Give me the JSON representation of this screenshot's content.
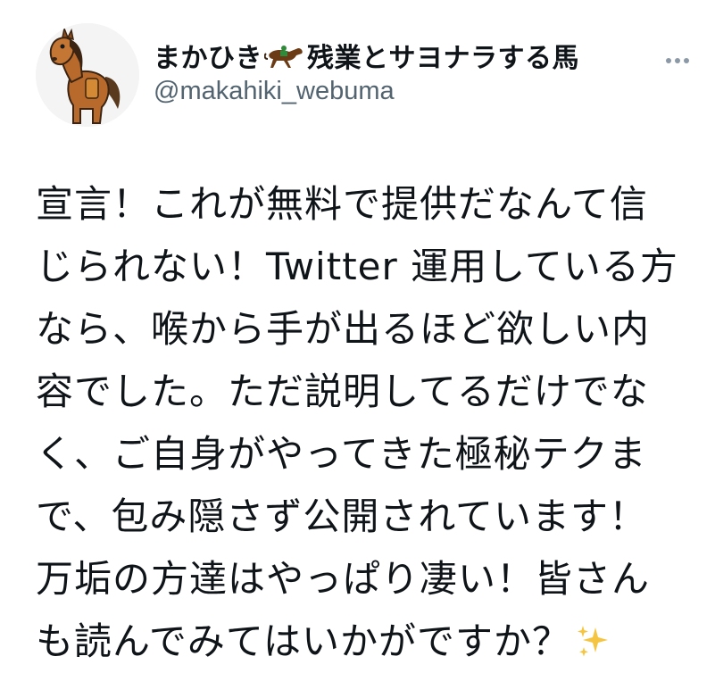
{
  "tweet": {
    "author": {
      "name_part1": "まかひき",
      "name_emoji": "racehorse-emoji",
      "name_part2": "残業とサヨナラする馬",
      "handle": "@makahiki_webuma"
    },
    "more_icon": "more-dots-icon",
    "lines": [
      "宣言！これが無料で提供だなんて信",
      "じられない！Twitter 運用している方",
      "なら、喉から手が出るほど欲しい内",
      "容でした。ただ説明してるだけでな",
      "く、ご自身がやってきた極秘テクま",
      "で、包み隠さず公開されています！",
      "万垢の方達はやっぱり凄い！皆さん",
      "も読んでみてはいかがですか？"
    ],
    "trailing_emoji": "sparkles-emoji"
  },
  "colors": {
    "text": "#0f1419",
    "secondary": "#536471",
    "sparkle": "#f5c542"
  }
}
